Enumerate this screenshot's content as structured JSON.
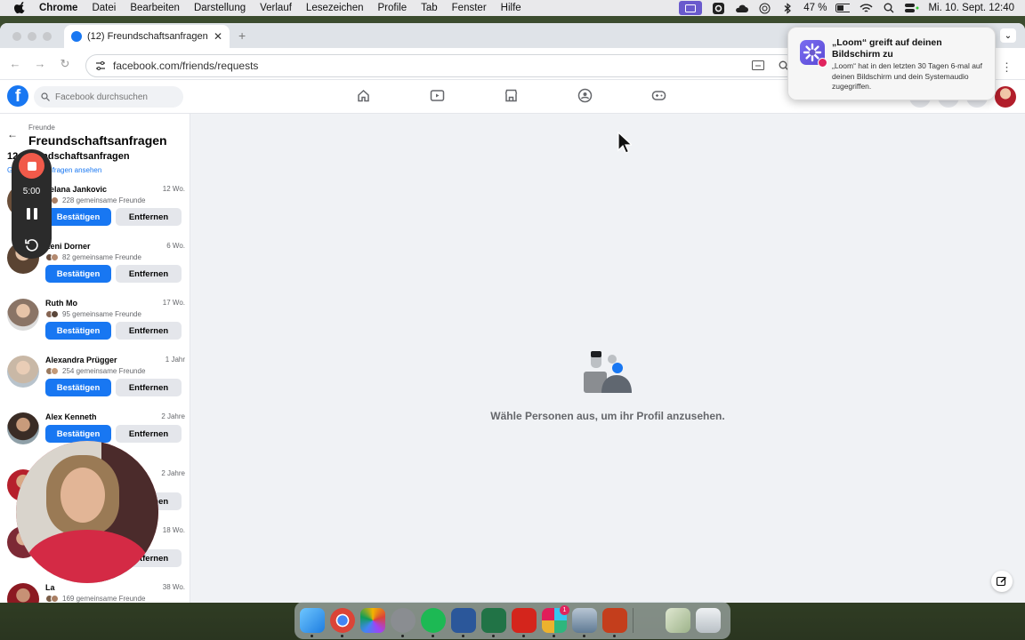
{
  "menubar": {
    "app": "Chrome",
    "items": [
      "Datei",
      "Bearbeiten",
      "Darstellung",
      "Verlauf",
      "Lesezeichen",
      "Profile",
      "Tab",
      "Fenster",
      "Hilfe"
    ],
    "battery": "47 %",
    "datetime": "Mi. 10. Sept. 12:40"
  },
  "browser": {
    "tab_title": "(12) Freundschaftsanfragen |",
    "url": "facebook.com/friends/requests"
  },
  "facebook": {
    "search_placeholder": "Facebook durchsuchen",
    "breadcrumb": "Freunde",
    "title": "Freundschaftsanfragen",
    "count_title": "12 Freundschaftsanfragen",
    "sent_link": "Gesendete Anfragen ansehen",
    "confirm_label": "Bestätigen",
    "remove_label": "Entfernen",
    "empty_text": "Wähle Personen aus, um ihr Profil anzusehen.",
    "requests": [
      {
        "name": "Jelana Jankovic",
        "mutual": "228 gemeinsame Freunde",
        "age": "12 Wo."
      },
      {
        "name": "Leni Dorner",
        "mutual": "82 gemeinsame Freunde",
        "age": "6 Wo."
      },
      {
        "name": "Ruth Mo",
        "mutual": "95 gemeinsame Freunde",
        "age": "17 Wo."
      },
      {
        "name": "Alexandra Prügger",
        "mutual": "254 gemeinsame Freunde",
        "age": "1 Jahr"
      },
      {
        "name": "Alex Kenneth",
        "mutual": "",
        "age": "2 Jahre"
      },
      {
        "name": "",
        "mutual": "",
        "age": "2 Jahre"
      },
      {
        "name": "",
        "mutual": "",
        "age": "18 Wo."
      },
      {
        "name": "La",
        "mutual": "169 gemeinsame Freunde",
        "age": "38 Wo."
      }
    ]
  },
  "notification": {
    "title": "„Loom“ greift auf deinen Bildschirm zu",
    "body": "„Loom“ hat in den letzten 30 Tagen 6-mal auf deinen Bildschirm und dein Systemaudio zugegriffen."
  },
  "loom": {
    "timer": "5:00"
  },
  "dock": {
    "badges": {
      "settings": "",
      "slack": "1"
    }
  },
  "colors": {
    "facebook_blue": "#1877f2",
    "loom_red": "#f15a4a",
    "loom_purple": "#6a5acd"
  }
}
